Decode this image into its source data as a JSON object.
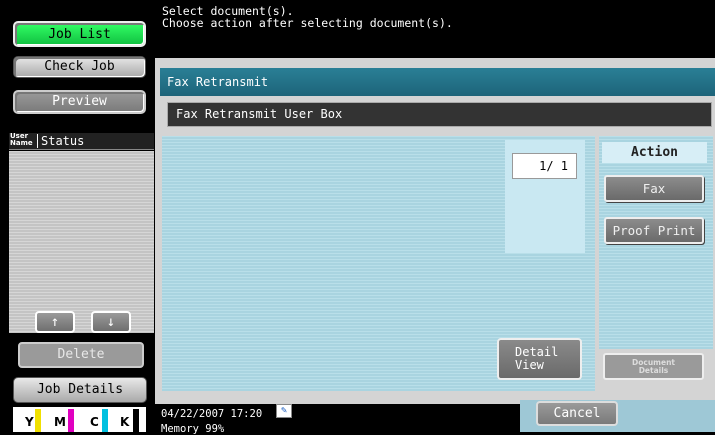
{
  "left": {
    "job_list": "Job List",
    "check_job": "Check Job",
    "preview": "Preview",
    "col_user_name_1": "User",
    "col_user_name_2": "Name",
    "col_status": "Status",
    "up_arrow": "↑",
    "down_arrow": "↓",
    "delete": "Delete",
    "job_details": "Job Details",
    "toner": [
      "Y",
      "M",
      "C",
      "K"
    ],
    "toner_colors": [
      "#f0e000",
      "#e000c0",
      "#00c0e0",
      "#000000"
    ]
  },
  "message": {
    "line1": "Select document(s).",
    "line2": "Choose action after selecting document(s)."
  },
  "panel": {
    "title": "Fax Retransmit",
    "box_name": "Fax Retransmit User Box",
    "page_counter": "1/  1",
    "detail_view_1": "Detail",
    "detail_view_2": "View"
  },
  "action": {
    "label": "Action",
    "fax": "Fax",
    "proof_print": "Proof Print",
    "document_details_1": "Document",
    "document_details_2": "Details"
  },
  "status_bar": {
    "datetime": "04/22/2007   17:20",
    "memory": "Memory      99%",
    "network_icon": "network-icon",
    "cancel": "Cancel"
  }
}
